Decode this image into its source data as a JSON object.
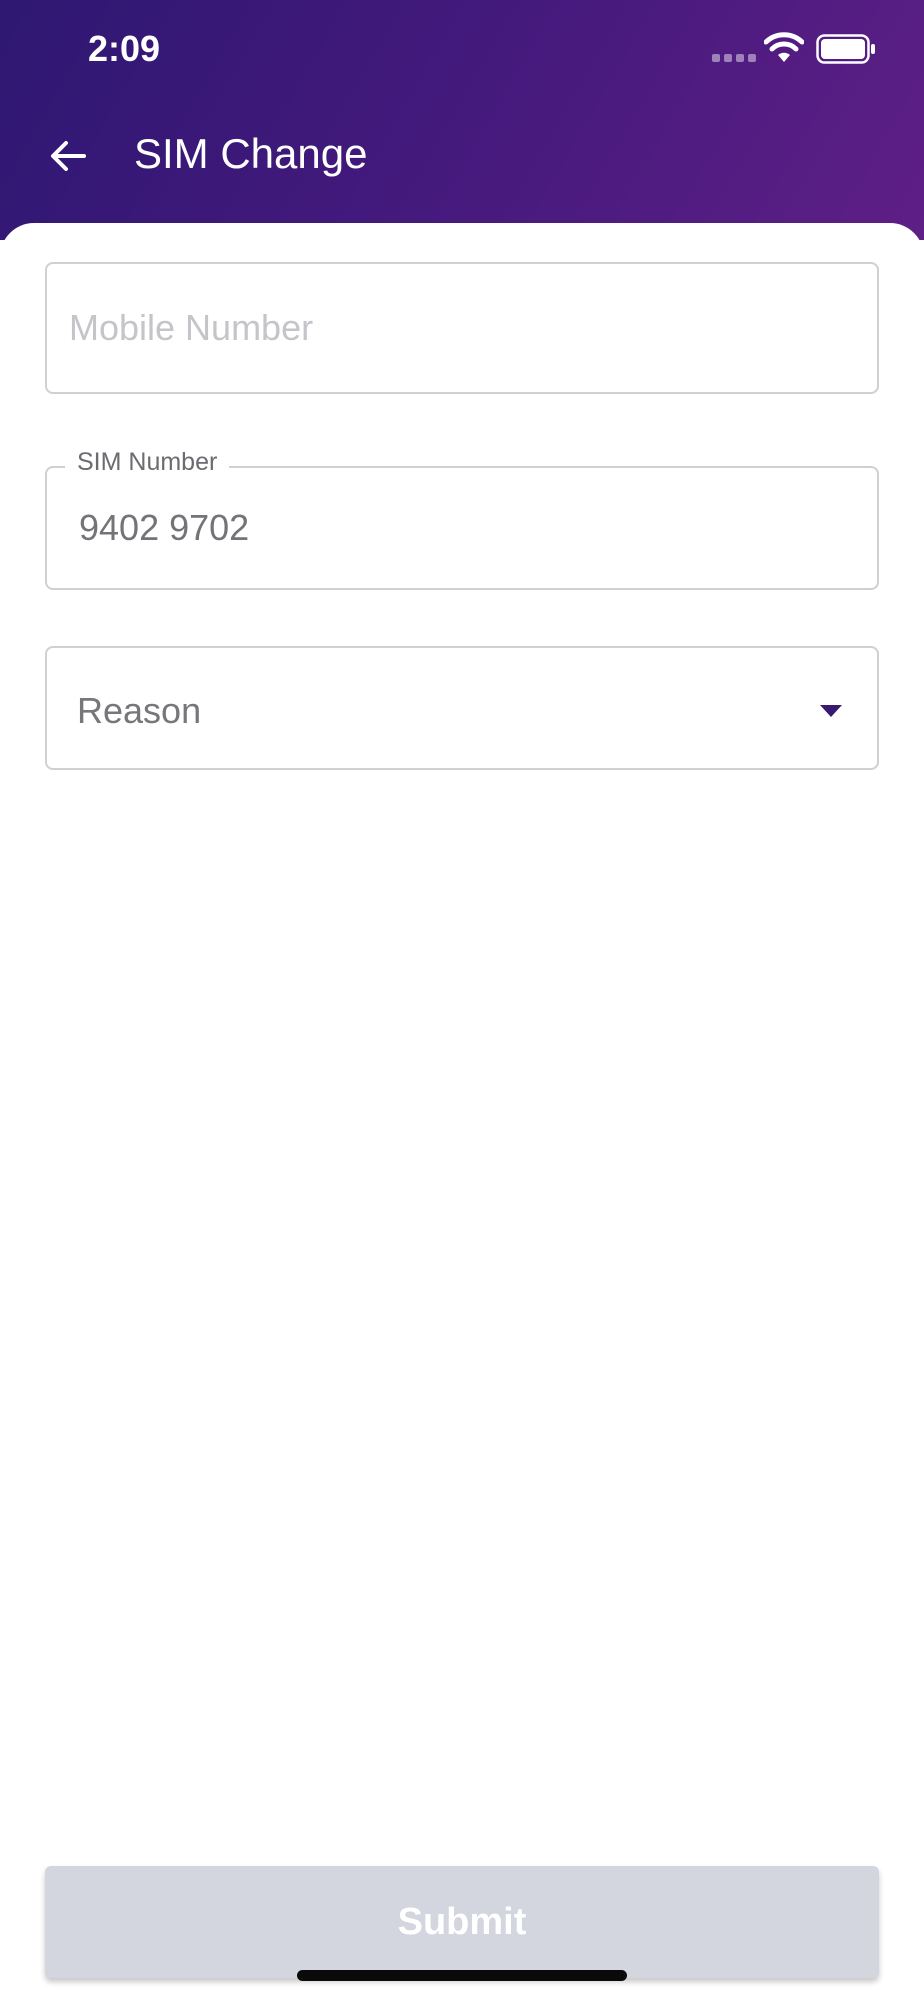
{
  "status_bar": {
    "time": "2:09",
    "signal_icon": "cellular-signal-icon",
    "wifi_icon": "wifi-icon",
    "battery_icon": "battery-icon"
  },
  "header": {
    "title": "SIM Change",
    "back_icon": "arrow-left-icon",
    "gradient_start": "#2e1872",
    "gradient_end": "#5e1f86"
  },
  "form": {
    "mobile_number": {
      "placeholder": "Mobile Number",
      "value": ""
    },
    "sim_number": {
      "label": "SIM Number",
      "value": "9402 9702"
    },
    "reason": {
      "label": "Reason",
      "icon": "dropdown-caret-icon",
      "accent": "#3a1a6e"
    }
  },
  "submit": {
    "label": "Submit",
    "background": "#d3d5df"
  }
}
